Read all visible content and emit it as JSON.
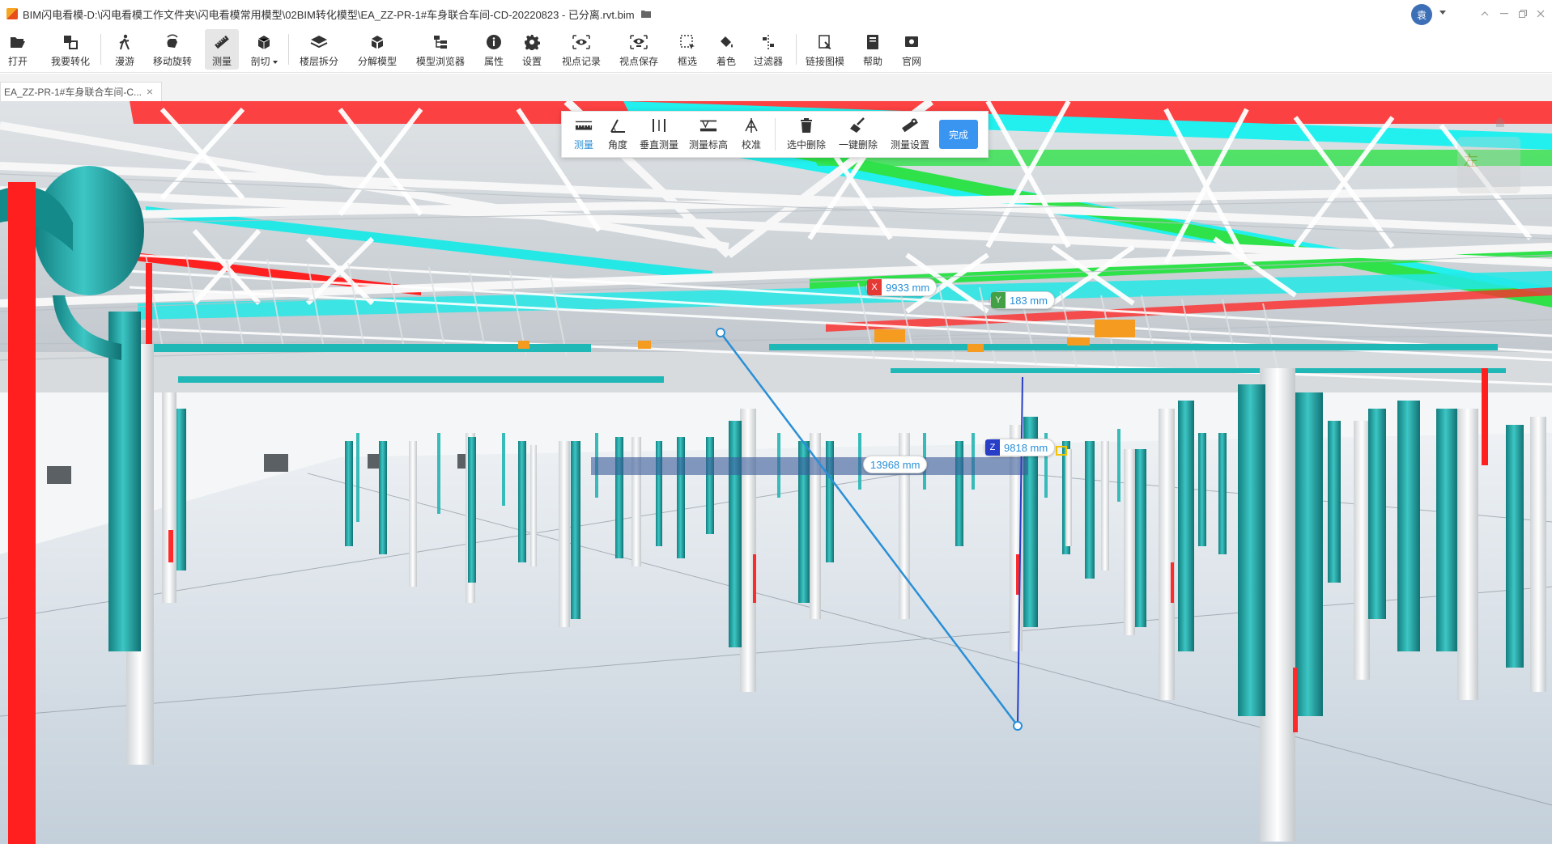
{
  "window": {
    "title": "BIM闪电看模-D:\\闪电看模工作文件夹\\闪电看模常用模型\\02BIM转化模型\\EA_ZZ-PR-1#车身联合车间-CD-20220823 - 已分离.rvt.bim",
    "user_initial": "袁"
  },
  "toolbar": {
    "items": [
      {
        "label": "打开",
        "icon": "folder-open-icon"
      },
      {
        "label": "我要转化",
        "icon": "convert-icon"
      },
      {
        "label": "漫游",
        "icon": "walk-icon"
      },
      {
        "label": "移动旋转",
        "icon": "rotate-hand-icon"
      },
      {
        "label": "测量",
        "icon": "ruler-icon"
      },
      {
        "label": "剖切",
        "icon": "section-box-icon"
      },
      {
        "label": "楼层拆分",
        "icon": "layers-icon"
      },
      {
        "label": "分解模型",
        "icon": "explode-icon"
      },
      {
        "label": "模型浏览器",
        "icon": "tree-icon"
      },
      {
        "label": "属性",
        "icon": "info-icon"
      },
      {
        "label": "设置",
        "icon": "gear-icon"
      },
      {
        "label": "视点记录",
        "icon": "eye-record-icon"
      },
      {
        "label": "视点保存",
        "icon": "eye-save-icon"
      },
      {
        "label": "框选",
        "icon": "box-select-icon"
      },
      {
        "label": "着色",
        "icon": "paint-bucket-icon"
      },
      {
        "label": "过滤器",
        "icon": "filter-icon"
      },
      {
        "label": "链接图模",
        "icon": "link-drawing-icon"
      },
      {
        "label": "帮助",
        "icon": "help-book-icon"
      },
      {
        "label": "官网",
        "icon": "website-icon"
      }
    ]
  },
  "doc_tab": {
    "label": "EA_ZZ-PR-1#车身联合车间-C...",
    "close": "×"
  },
  "measure_toolbar": {
    "items": [
      {
        "label": "测量",
        "icon": "measure-ruler-icon"
      },
      {
        "label": "角度",
        "icon": "angle-icon"
      },
      {
        "label": "垂直测量",
        "icon": "vertical-measure-icon"
      },
      {
        "label": "测量标高",
        "icon": "elevation-icon"
      },
      {
        "label": "校准",
        "icon": "calibrate-icon"
      },
      {
        "label": "选中删除",
        "icon": "trash-icon"
      },
      {
        "label": "一键删除",
        "icon": "broom-icon"
      },
      {
        "label": "测量设置",
        "icon": "measure-settings-icon"
      }
    ],
    "done_label": "完成"
  },
  "measurement": {
    "x_axis": "X",
    "x_value": "9933 mm",
    "y_axis": "Y",
    "y_value": "183 mm",
    "z_axis": "Z",
    "z_value": "9818 mm",
    "total_value": "13968 mm",
    "colors": {
      "x": "#e53935",
      "y": "#43a047",
      "z": "#283ec8",
      "line": "#2a8fd6"
    }
  },
  "view_cube": {
    "face_label": "左"
  }
}
